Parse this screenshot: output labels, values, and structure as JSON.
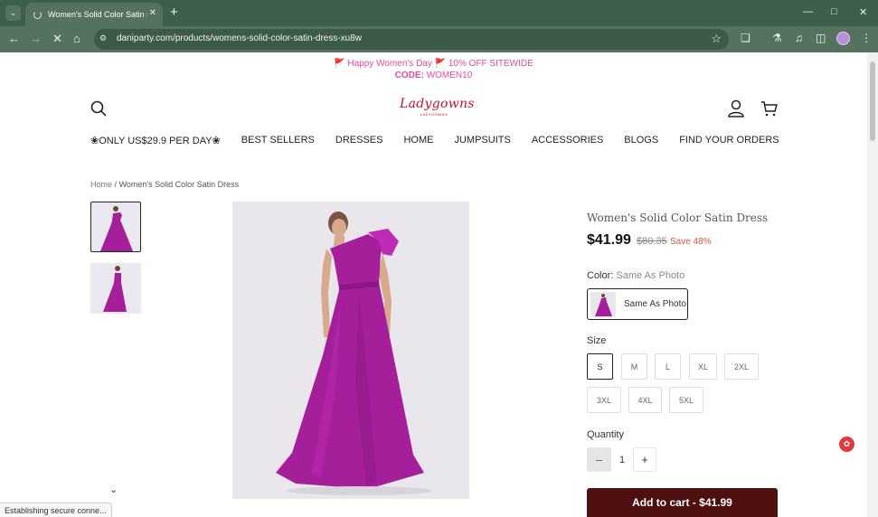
{
  "browser": {
    "tab_title": "Women's Solid Color Satin Dress",
    "url": "daniparty.com/products/womens-solid-color-satin-dress-xu8w",
    "status": "Establishing secure conne..."
  },
  "promo": {
    "line1": "🚩 Happy Women's Day 🚩  10% OFF SITEWIDE",
    "code_label": "CODE:",
    "code_value": "WOMEN10"
  },
  "header": {
    "logo_text": "Ladygowns",
    "logo_sub": "LADYGOWNS"
  },
  "nav": {
    "items": [
      "❀ONLY US$29.9 PER DAY❀",
      "BEST SELLERS",
      "DRESSES",
      "HOME",
      "JUMPSUITS",
      "ACCESSORIES",
      "BLOGS",
      "FIND YOUR ORDERS"
    ]
  },
  "breadcrumb": {
    "home": "Home",
    "sep": "/",
    "current": "Women's Solid Color Satin Dress"
  },
  "product": {
    "title": "Women's Solid Color Satin Dress",
    "price": "$41.99",
    "compare_price": "$80.35",
    "save": "Save 48%",
    "color_label": "Color:",
    "color_value": "Same As Photo",
    "color_option": "Same As Photo",
    "size_label": "Size",
    "sizes": [
      "S",
      "M",
      "L",
      "XL",
      "2XL",
      "3XL",
      "4XL",
      "5XL"
    ],
    "selected_size": "S",
    "quantity_label": "Quantity",
    "quantity": "1",
    "add_to_cart": "Add to cart - $41.99"
  },
  "colors": {
    "promo": "#e84a9c",
    "logo": "#c8102e",
    "save": "#e1543d",
    "add_to_cart_bg": "#4d0f0f",
    "dress": "#a51f9b",
    "chrome": "#3e5f49"
  }
}
